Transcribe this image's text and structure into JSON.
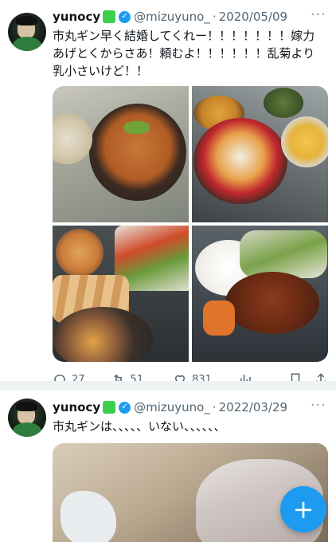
{
  "tweets": [
    {
      "name": "yunocy",
      "handle": "@mizuyuno_",
      "dot": "·",
      "date": "2020/05/09",
      "more": "···",
      "text": "市丸ギン早く結婚してくれー！！！！！！！嫁力あげとくからさあ！頼むよ！！！！！！乱菊より乳小さいけど！！",
      "stats": {
        "replies": "27",
        "retweets": "51",
        "likes": "831"
      }
    },
    {
      "name": "yunocy",
      "handle": "@mizuyuno_",
      "dot": "·",
      "date": "2022/03/29",
      "more": "···",
      "text": "市丸ギンは、、、、、いない、、、、、、"
    }
  ],
  "fab": {
    "label": "+"
  },
  "colors": {
    "accent": "#1d9bf0",
    "muted": "#536471",
    "green_heart": "#3ccf4e"
  },
  "icons": [
    "reply-icon",
    "retweet-icon",
    "like-icon",
    "views-icon",
    "bookmark-icon",
    "share-icon",
    "verified-badge-icon",
    "green-heart-icon",
    "more-icon",
    "compose-icon"
  ]
}
